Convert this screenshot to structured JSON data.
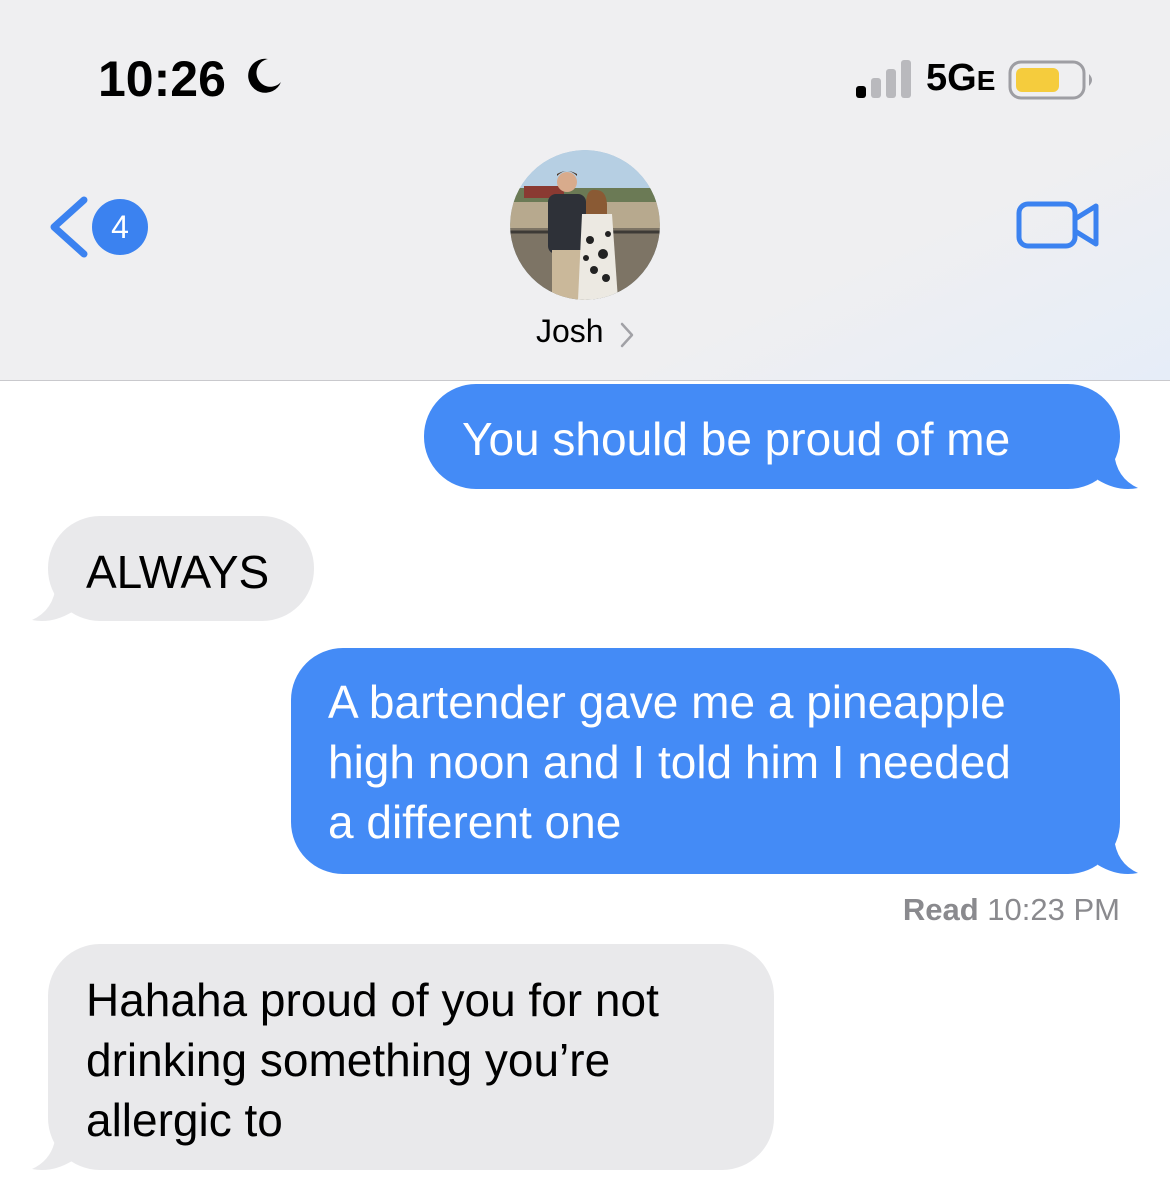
{
  "status_bar": {
    "time": "10:26",
    "network": "5G",
    "network_suffix": "E",
    "battery_color": "#f5cc3d",
    "icons": [
      "moon-icon",
      "cellular-signal-icon",
      "battery-icon"
    ]
  },
  "nav": {
    "back_badge": "4",
    "contact_name": "Josh",
    "icons": [
      "back-chevron-icon",
      "chevron-right-icon",
      "video-camera-icon"
    ]
  },
  "colors": {
    "sent_bubble": "#448bf6",
    "received_bubble": "#e9e9eb",
    "accent": "#3b82f0"
  },
  "messages": [
    {
      "direction": "sent",
      "lines": [
        "You should be proud of me"
      ]
    },
    {
      "direction": "received",
      "lines": [
        "ALWAYS"
      ]
    },
    {
      "direction": "sent",
      "lines": [
        "A bartender gave me a pineapple",
        "high noon and I told him I needed",
        "a different one"
      ]
    },
    {
      "direction": "received",
      "lines": [
        "Hahaha proud of you for not",
        "drinking something you’re",
        "allergic to"
      ]
    }
  ],
  "read_receipt": {
    "label": "Read",
    "time": "10:23 PM"
  }
}
